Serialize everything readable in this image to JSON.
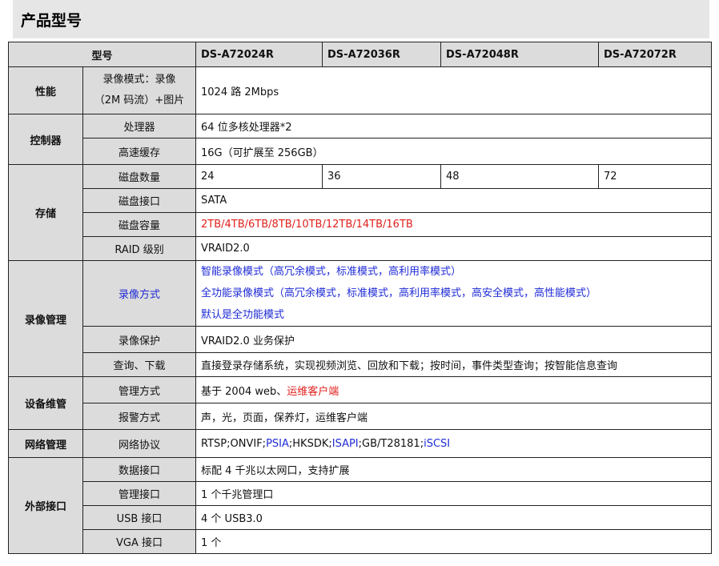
{
  "page": {
    "title": "产品型号"
  },
  "header": {
    "label": "型号",
    "models": [
      "DS-A72024R",
      "DS-A72036R",
      "DS-A72048R",
      "DS-A72072R"
    ]
  },
  "performance": {
    "category": "性能",
    "row": {
      "label_line1": "录像模式：录像",
      "label_line2": "（2M 码流）+图片",
      "value": "1024 路 2Mbps"
    }
  },
  "controller": {
    "category": "控制器",
    "processor": {
      "label": "处理器",
      "value": "64 位多核处理器*2"
    },
    "cache": {
      "label": "高速缓存",
      "value": "16G（可扩展至 256GB）"
    }
  },
  "storage": {
    "category": "存储",
    "disk_count": {
      "label": "磁盘数量",
      "values": [
        "24",
        "36",
        "48",
        "72"
      ]
    },
    "disk_interface": {
      "label": "磁盘接口",
      "value": "SATA"
    },
    "disk_capacity": {
      "label": "磁盘容量",
      "value": "2TB/4TB/6TB/8TB/10TB/12TB/14TB/16TB",
      "color": "#e0201c"
    },
    "raid": {
      "label": "RAID 级别",
      "value": "VRAID2.0"
    }
  },
  "recording": {
    "category": "录像管理",
    "mode": {
      "label": "录像方式",
      "label_color": "#1f2bd6",
      "lines": [
        "智能录像模式（高冗余模式，标准模式，高利用率模式）",
        "全功能录像模式（高冗余模式，标准模式，高利用率模式，高安全模式，高性能模式）",
        "默认是全功能模式"
      ],
      "value_color": "#1f2bd6"
    },
    "protection": {
      "label": "录像保护",
      "value": "VRAID2.0 业务保护"
    },
    "query": {
      "label": "查询、下载",
      "value": "直接登录存储系统，实现视频浏览、回放和下载；按时间，事件类型查询；按智能信息查询"
    }
  },
  "maintenance": {
    "category": "设备维管",
    "method": {
      "label": "管理方式",
      "value_prefix": "基于 2004 web、",
      "value_highlight": "运维客户端",
      "highlight_color": "#e0201c"
    },
    "alarm": {
      "label": "报警方式",
      "value": "声，光，页面，保养灯，运维客户端"
    }
  },
  "network": {
    "category": "网络管理",
    "protocol": {
      "label": "网络协议",
      "parts": [
        "RTSP;ONVIF;",
        "PSIA",
        ";HKSDK;",
        "ISAPI",
        ";GB/T28181;",
        "iSCSI"
      ],
      "blue_color": "#1f2bd6"
    }
  },
  "interfaces": {
    "category": "外部接口",
    "data": {
      "label": "数据接口",
      "value": "标配 4 千兆以太网口，支持扩展"
    },
    "mgmt": {
      "label": "管理接口",
      "value": "1 个千兆管理口"
    },
    "usb": {
      "label": "USB 接口",
      "value": "4 个 USB3.0"
    },
    "vga": {
      "label": "VGA 接口",
      "value": "1 个"
    }
  },
  "colors": {
    "header_bg": "#dcdcdc",
    "title_bg": "#e6e6e6",
    "red": "#e0201c",
    "blue": "#1f2bd6"
  }
}
